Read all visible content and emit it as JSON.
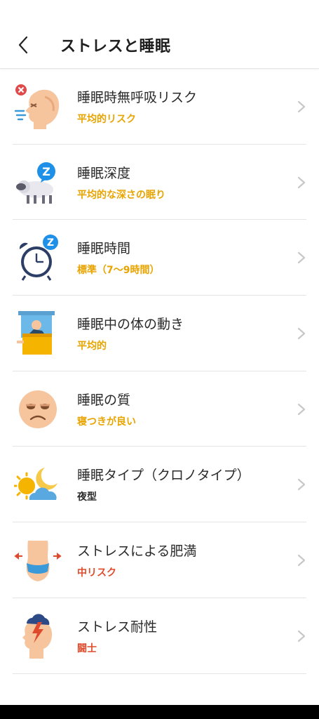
{
  "header": {
    "title": "ストレスと睡眠",
    "back_icon": "chevron-left-icon"
  },
  "colors": {
    "orange": "#e8a400",
    "red": "#e04a2c",
    "dark": "#2b2b2b",
    "chevron": "#c8c8c8"
  },
  "items": [
    {
      "label": "睡眠時無呼吸リスク",
      "status": "平均的リスク",
      "status_color": "#e8a400",
      "icon": "apnea-face-icon"
    },
    {
      "label": "睡眠深度",
      "status": "平均的な深さの眠り",
      "status_color": "#e8a400",
      "icon": "sheep-sleep-icon"
    },
    {
      "label": "睡眠時間",
      "status": "標準（7〜9時間）",
      "status_color": "#e8a400",
      "icon": "alarm-clock-icon"
    },
    {
      "label": "睡眠中の体の動き",
      "status": "平均的",
      "status_color": "#e8a400",
      "icon": "person-in-bed-icon"
    },
    {
      "label": "睡眠の質",
      "status": "寝つきが良い",
      "status_color": "#e8a400",
      "icon": "tired-face-icon"
    },
    {
      "label": "睡眠タイプ（クロノタイプ）",
      "status": "夜型",
      "status_color": "#2b2b2b",
      "icon": "sun-moon-cloud-icon"
    },
    {
      "label": "ストレスによる肥満",
      "status": "中リスク",
      "status_color": "#e04a2c",
      "icon": "waist-icon"
    },
    {
      "label": "ストレス耐性",
      "status": "闘士",
      "status_color": "#e04a2c",
      "icon": "stress-head-icon"
    }
  ]
}
